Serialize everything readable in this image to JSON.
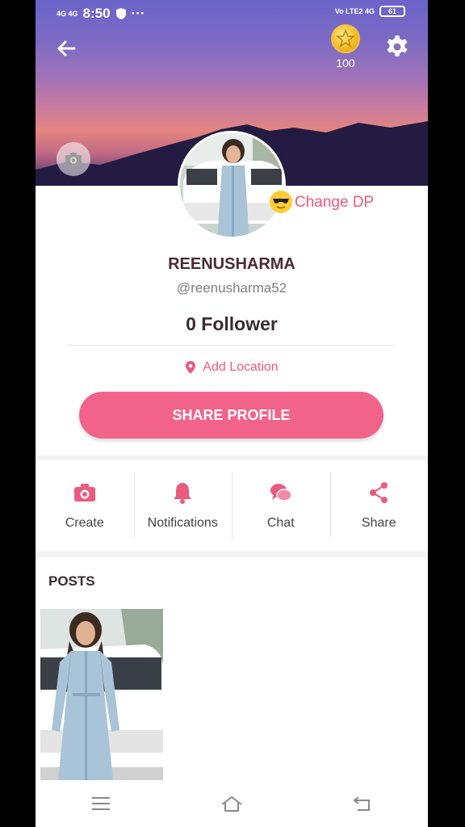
{
  "statusbar": {
    "network_left": "4G 4G",
    "time": "8:50",
    "more": "···",
    "network_right": "Vo LTE2 4G",
    "battery": "61"
  },
  "header": {
    "coins": "100"
  },
  "profile": {
    "change_dp": "Change DP",
    "username": "REENUSHARMA",
    "handle": "@reenusharma52",
    "followers": "0 Follower",
    "add_location": "Add Location",
    "share_profile": "SHARE PROFILE"
  },
  "actions": [
    {
      "label": "Create",
      "icon": "camera-icon"
    },
    {
      "label": "Notifications",
      "icon": "bell-icon"
    },
    {
      "label": "Chat",
      "icon": "chat-icon"
    },
    {
      "label": "Share",
      "icon": "share-icon"
    }
  ],
  "posts": {
    "title": "POSTS"
  },
  "colors": {
    "accent": "#f16389",
    "accent_text": "#ec5a7f"
  }
}
